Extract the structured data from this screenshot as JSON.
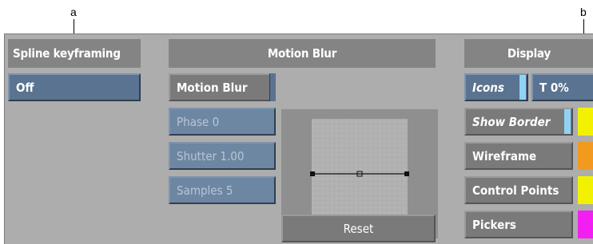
{
  "callouts": {
    "a": "a",
    "b": "b"
  },
  "spline": {
    "header": "Spline keyframing",
    "value": "Off"
  },
  "motion_blur": {
    "header": "Motion Blur",
    "toggle_label": "Motion Blur",
    "phase": "Phase 0",
    "shutter": "Shutter 1.00",
    "samples": "Samples 5",
    "reset_label": "Reset"
  },
  "display": {
    "header": "Display",
    "icons_label": "Icons",
    "transparency_label": "T 0%",
    "show_border_label": "Show Border",
    "wireframe_label": "Wireframe",
    "control_points_label": "Control Points",
    "pickers_label": "Pickers"
  },
  "colors": {
    "panel_bg": "#adadad",
    "header_bg": "#848484",
    "button_blue": "#5a7390",
    "indicator_cyan": "#8fd3f4",
    "swatch_yellow": "#f2f200",
    "swatch_orange": "#f29a1e",
    "swatch_magenta": "#f21ef2"
  }
}
